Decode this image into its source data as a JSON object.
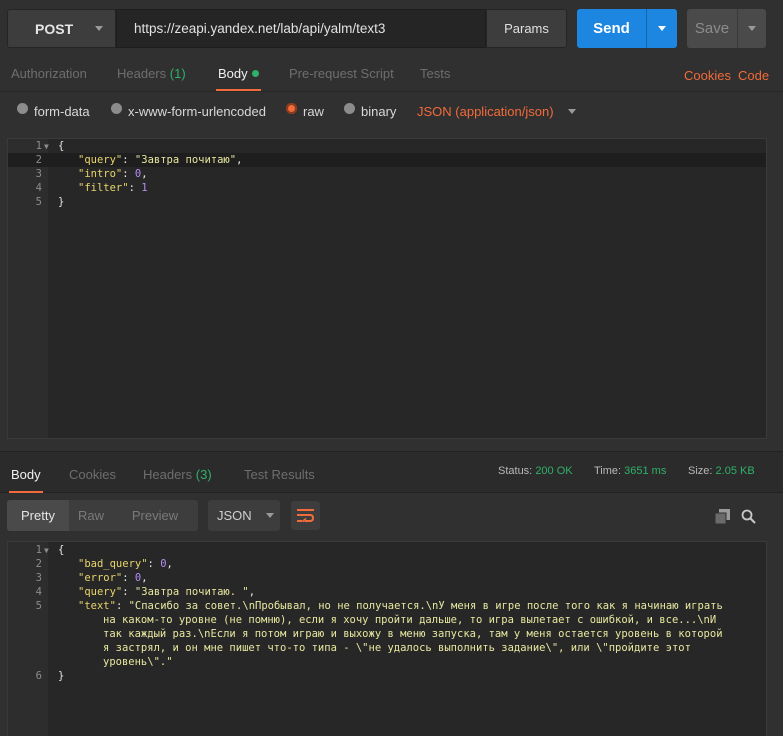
{
  "request": {
    "method": "POST",
    "url": "https://zeapi.yandex.net/lab/api/yalm/text3",
    "params_label": "Params",
    "send_label": "Send",
    "save_label": "Save"
  },
  "request_tabs": {
    "authorization": "Authorization",
    "headers": "Headers",
    "headers_count": "(1)",
    "body": "Body",
    "prerequest": "Pre-request Script",
    "tests": "Tests",
    "cookies": "Cookies",
    "code": "Code"
  },
  "body_types": {
    "form_data": "form-data",
    "urlencoded": "x-www-form-urlencoded",
    "raw": "raw",
    "binary": "binary",
    "selected": "raw",
    "content_type": "JSON (application/json)"
  },
  "request_body": {
    "line_numbers": [
      "1",
      "2",
      "3",
      "4",
      "5"
    ],
    "l1": "{",
    "q_key": "\"query\"",
    "q_val": "\"Завтра почитаю\"",
    "i_key": "\"intro\"",
    "i_val": "0",
    "f_key": "\"filter\"",
    "f_val": "1",
    "l5": "}"
  },
  "response_tabs": {
    "body": "Body",
    "cookies": "Cookies",
    "headers": "Headers",
    "headers_count": "(3)",
    "test_results": "Test Results"
  },
  "response_status": {
    "status_label": "Status:",
    "status_value": "200 OK",
    "time_label": "Time:",
    "time_value": "3651 ms",
    "size_label": "Size:",
    "size_value": "2.05 KB"
  },
  "response_view": {
    "pretty": "Pretty",
    "raw": "Raw",
    "preview": "Preview",
    "format": "JSON"
  },
  "response_body": {
    "line_numbers": [
      "1",
      "2",
      "3",
      "4",
      "5",
      "6"
    ],
    "l1": "{",
    "bq_key": "\"bad_query\"",
    "bq_val": "0",
    "err_key": "\"error\"",
    "err_val": "0",
    "q_key": "\"query\"",
    "q_val": "\"Завтра почитаю. \"",
    "text_key": "\"text\"",
    "text_lines": [
      "\"Спасибо за совет.\\nПробывал, но не получается.\\nУ меня в игре после того как я начинаю играть",
      "на каком-то уровне (не помню), если я хочу пройти дальше, то игра вылетает с ошибкой, и все...\\nИ",
      "так каждый раз.\\nЕсли я потом играю и выхожу в меню запуска, там у меня остается уровень в которой",
      "я застрял, и он мне пишет что-то типа - \\\"не удалось выполнить задание\\\", или \\\"пройдите этот",
      "уровень\\\".\""
    ],
    "l6": "}"
  },
  "icons": [
    "chevron-down-icon",
    "copy-icon",
    "search-icon",
    "wrap-lines-icon"
  ],
  "colors": {
    "accent": "#f26b3a",
    "send": "#1d86e0",
    "success": "#2fb16a"
  }
}
